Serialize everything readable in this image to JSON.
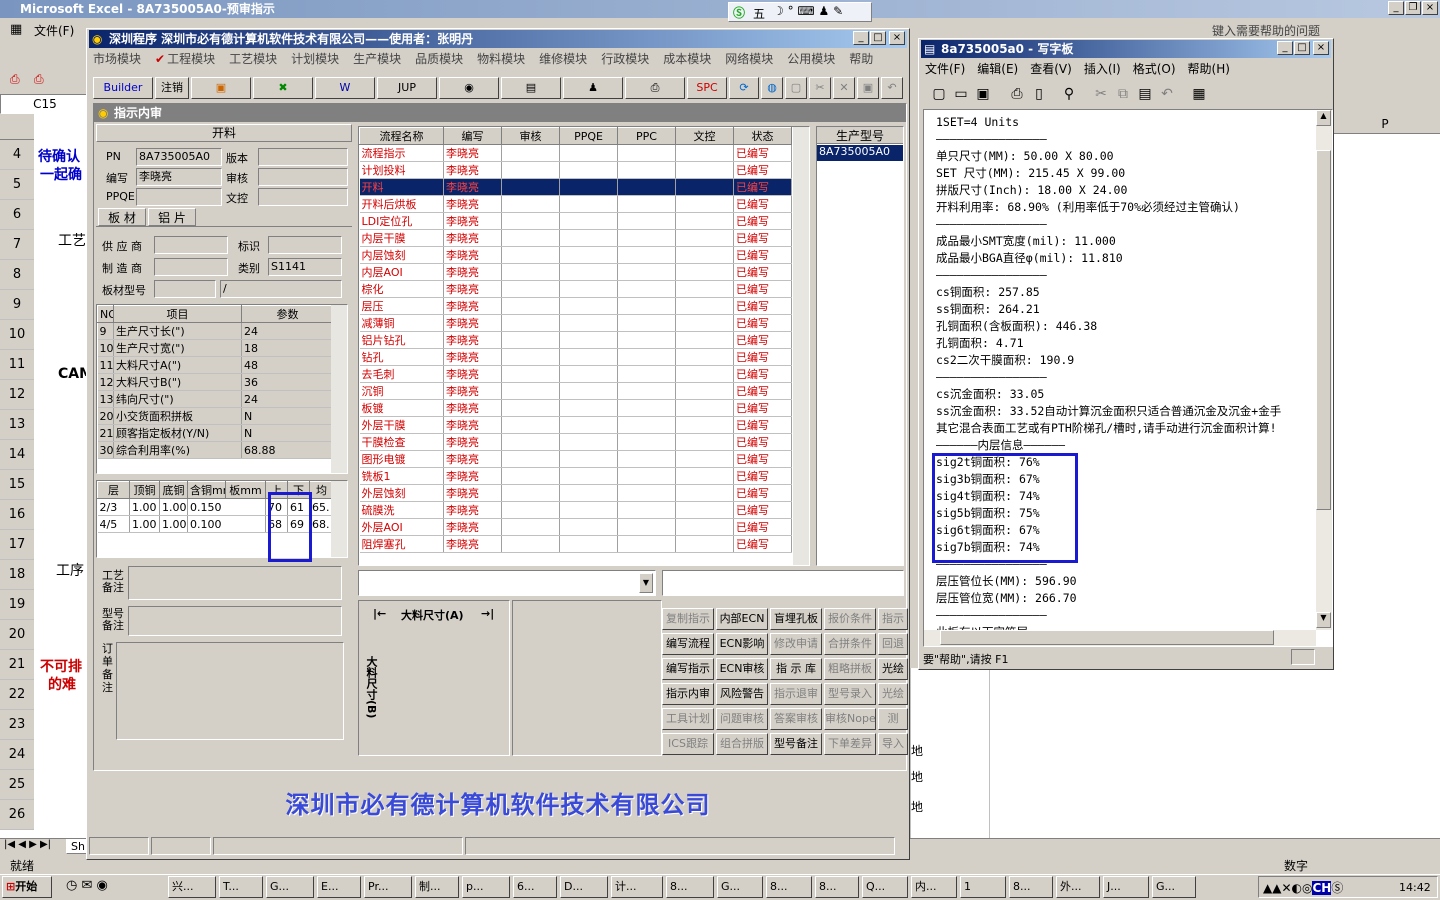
{
  "excel": {
    "title": "Microsoft Excel - 8A735005A0-预审指示",
    "menu": [
      "文件(F)"
    ],
    "help_placeholder": "键入需要帮助的问题",
    "namebox": "C15",
    "rows": [
      "4",
      "5",
      "6",
      "7",
      "8",
      "9",
      "10",
      "11",
      "12",
      "13",
      "14",
      "15",
      "16",
      "17",
      "18",
      "19",
      "20",
      "21",
      "22",
      "23",
      "24",
      "25",
      "26"
    ],
    "cells": {
      "r4": "待确认",
      "r5": "一起确",
      "r7": "工艺",
      "r11": "CAM",
      "r18": "工序",
      "r21": "不可排",
      "r22": "的难",
      "col_p": "P",
      "di1": "地",
      "di2": "地",
      "di3": "地"
    },
    "sheet_tab": "Sh",
    "status": "就绪",
    "status_right": "数字"
  },
  "ime": {
    "text": "五"
  },
  "app": {
    "title": "深圳程序  深圳市必有德计算机软件技术有限公司——使用者：张明丹",
    "menu": [
      "市场模块",
      "工程模块",
      "工艺模块",
      "计划模块",
      "生产模块",
      "品质模块",
      "物料模块",
      "维修模块",
      "行政模块",
      "成本模块",
      "网络模块",
      "公用模块",
      "帮助"
    ],
    "toolbar": {
      "builder": "Builder",
      "logout": "注销",
      "jup": "JUP",
      "spc": "SPC"
    },
    "sub_title": "指示内审",
    "section": "开料",
    "fields": {
      "pn_label": "PN",
      "pn": "8A735005A0",
      "version_label": "版本",
      "editor_label": "编写",
      "editor": "李晓亮",
      "review_label": "审核",
      "ppqe_label": "PPQE",
      "doc_label": "文控"
    },
    "tabs": [
      "板 材",
      "铝 片"
    ],
    "material": {
      "supplier_label": "供 应 商",
      "mark_label": "标识",
      "maker_label": "制 造 商",
      "type_label": "类别",
      "type": "S1141",
      "model_label": "板材型号",
      "model": "/"
    },
    "params": {
      "headers": [
        "NO",
        "项目",
        "参数"
      ],
      "rows": [
        [
          "9",
          "生产尺寸长(\")",
          "24"
        ],
        [
          "10",
          "生产尺寸宽(\")",
          "18"
        ],
        [
          "11",
          "大料尺寸A(\")",
          "48"
        ],
        [
          "12",
          "大料尺寸B(\")",
          "36"
        ],
        [
          "13",
          "纬向尺寸(\")",
          "24"
        ],
        [
          "20",
          "小交货面积拼板",
          "N"
        ],
        [
          "21",
          "顾客指定板材(Y/N)",
          "N"
        ],
        [
          "30",
          "综合利用率(%)",
          "68.88"
        ]
      ]
    },
    "layers": {
      "headers": [
        "层",
        "顶铜",
        "底铜",
        "含铜mm",
        "板mm",
        "上",
        "下",
        "均"
      ],
      "rows": [
        [
          "2/3",
          "1.00",
          "1.00",
          "0.150",
          "70",
          "61",
          "65."
        ],
        [
          "4/5",
          "1.00",
          "1.00",
          "0.100",
          "68",
          "69",
          "68."
        ]
      ]
    },
    "notes": {
      "craft": "工艺备注",
      "model": "型号备注",
      "order": "订单备注"
    },
    "flow": {
      "headers": [
        "流程名称",
        "编写",
        "审核",
        "PPQE",
        "PPC",
        "文控",
        "状态"
      ],
      "rows": [
        "流程指示",
        "计划投料",
        "开料",
        "开料后烘板",
        "LDI定位孔",
        "内层干膜",
        "内层蚀刻",
        "内层AOI",
        "棕化",
        "层压",
        "减薄铜",
        "铝片钻孔",
        "钻孔",
        "去毛刺",
        "沉铜",
        "板镀",
        "外层干膜",
        "干膜检查",
        "图形电镀",
        "铣板1",
        "外层蚀刻",
        "硫膜洗",
        "外层AOI",
        "阻焊塞孔"
      ],
      "editor": "李晓亮",
      "status": "已编写"
    },
    "prod": {
      "header": "生产型号",
      "value": "8A735005A0"
    },
    "diagram": {
      "a": "大料尺寸(A)",
      "b": "大料尺寸(B)"
    },
    "buttons": [
      [
        "复制指示",
        "内部ECN",
        "盲埋孔板",
        "报价条件",
        "指示"
      ],
      [
        "编写流程",
        "ECN影响",
        "修改申请",
        "合拼条件",
        "回退"
      ],
      [
        "编写指示",
        "ECN审核",
        "指 示 库",
        "粗略拼板",
        "光绘"
      ],
      [
        "指示内审",
        "风险警告",
        "指示退审",
        "型号录入",
        "光绘"
      ],
      [
        "工具计划",
        "问题审核",
        "答案审核",
        "审核Nope",
        "测"
      ],
      [
        "ICS跟踪",
        "组合拼版",
        "型号备注",
        "下单差异",
        "导入"
      ]
    ],
    "footer_logo": "深圳市必有德计算机软件技术有限公司"
  },
  "wordpad": {
    "title": "8a735005a0 - 写字板",
    "menu": [
      "文件(F)",
      "编辑(E)",
      "查看(V)",
      "插入(I)",
      "格式(O)",
      "帮助(H)"
    ],
    "lines": [
      "1SET=4 Units",
      "————————————————",
      "单只尺寸(MM): 50.00 X 80.00",
      "SET 尺寸(MM): 215.45 X 99.00",
      "拼版尺寸(Inch): 18.00 X 24.00",
      "开料利用率: 68.90% (利用率低于70%必须经过主管确认)",
      "————————————————",
      "成品最小SMT宽度(mil): 11.000",
      "成品最小BGA直径φ(mil): 11.810",
      "————————————————",
      "cs铜面积: 257.85",
      "ss铜面积: 264.21",
      "孔铜面积(含板面积): 446.38",
      "孔铜面积: 4.71",
      "cs2二次干膜面积: 190.9",
      "————————————————",
      "cs沉金面积: 33.05",
      "ss沉金面积: 33.52自动计算沉金面积只适合普通沉金及沉金+金手",
      "其它混合表面工艺或有PTH阶梯孔/槽时,请手动进行沉金面积计算!",
      "——————内层信息——————",
      "sig2t铜面积: 76%",
      "sig3b铜面积: 67%",
      "sig4t铜面积: 74%",
      "sig5b铜面积: 75%",
      "sig6t铜面积: 67%",
      "sig7b铜面积: 74%",
      "————————————————",
      "层压管位长(MM): 596.90",
      "层压管位宽(MM): 266.70",
      "————————————————",
      "此板有以下字符层"
    ],
    "status": "要\"帮助\",请按 F1"
  },
  "taskbar": {
    "start": "开始",
    "items": [
      "兴...",
      "T...",
      "G...",
      "E...",
      "Pr...",
      "制...",
      "p...",
      "6...",
      "D...",
      "计...",
      "8...",
      "G...",
      "8...",
      "8...",
      "Q...",
      "内...",
      "1",
      "8...",
      "外...",
      "J...",
      "G..."
    ],
    "clock": "14:42"
  }
}
